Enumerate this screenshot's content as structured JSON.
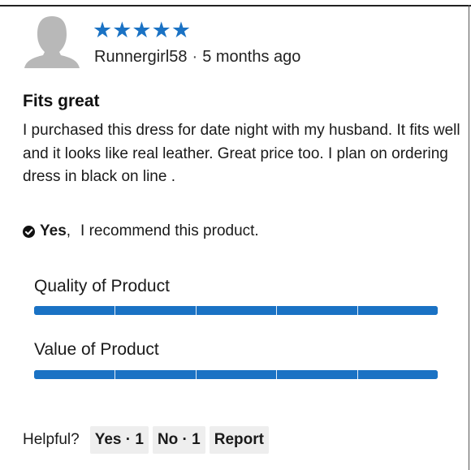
{
  "review": {
    "rating": 5,
    "rating_max": 5,
    "stars": "★★★★★",
    "author": "Runnergirl58",
    "separator": "·",
    "time_ago": "5 months ago",
    "title": "Fits great",
    "body": "I purchased this dress for date night with my husband. It fits well and it looks like real leather. Great price too. I plan on ordering dress in black on line ."
  },
  "recommendation": {
    "answer": "Yes",
    "comma": ",",
    "text": "I recommend this product.",
    "icon": "check-circle-icon"
  },
  "ratings": [
    {
      "label": "Quality of Product",
      "value": 5,
      "max": 5
    },
    {
      "label": "Value of Product",
      "value": 5,
      "max": 5
    }
  ],
  "helpful": {
    "label": "Helpful?",
    "yes_label": "Yes · 1",
    "no_label": "No · 1",
    "report_label": "Report"
  },
  "colors": {
    "star": "#1a72c4",
    "bar": "#1a72c4",
    "pill_bg": "#eeeeee"
  }
}
